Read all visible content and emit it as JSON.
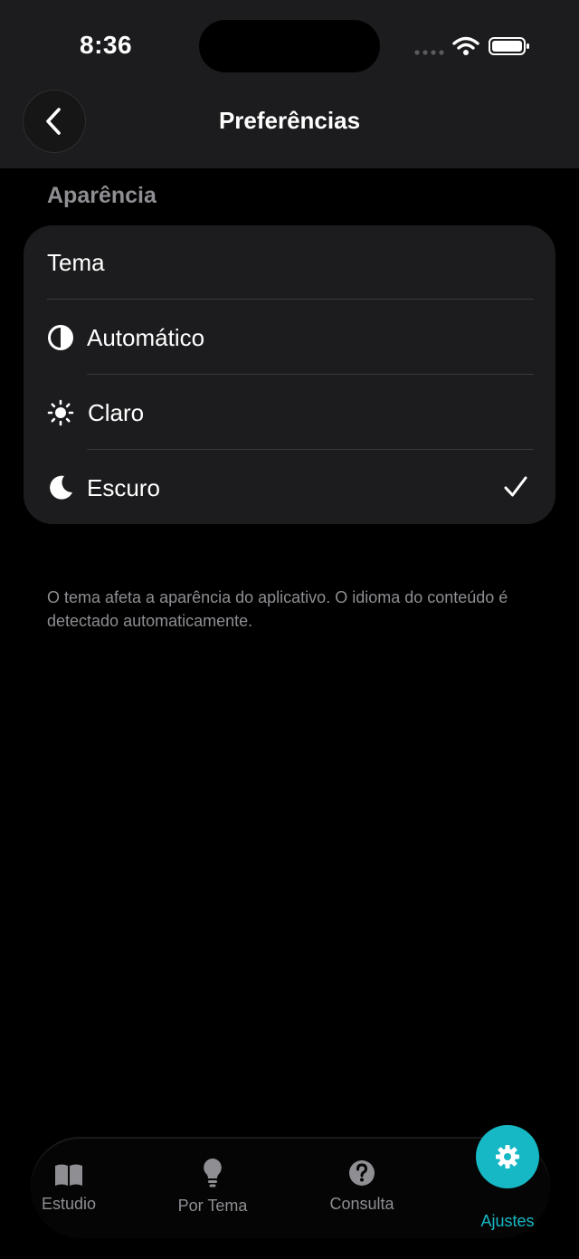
{
  "status_bar": {
    "time": "8:36",
    "icons": [
      "signal-dots-icon",
      "wifi-icon",
      "battery-icon"
    ]
  },
  "nav": {
    "title": "Preferências",
    "back_icon": "chevron-left-icon"
  },
  "appearance": {
    "section_title": "Aparência",
    "theme_header": "Tema",
    "options": [
      {
        "label": "Automático",
        "icon": "half-circle-icon",
        "selected": false
      },
      {
        "label": "Claro",
        "icon": "sun-icon",
        "selected": false
      },
      {
        "label": "Escuro",
        "icon": "moon-icon",
        "selected": true
      }
    ]
  },
  "footnote": "O tema afeta a aparência do aplicativo. O idioma do conteúdo é detectado automaticamente.",
  "tab_bar": {
    "tabs": [
      {
        "label": "Estudio",
        "icon": "book-icon",
        "active": false
      },
      {
        "label": "Por Tema",
        "icon": "lightbulb-icon",
        "active": false
      },
      {
        "label": "Consulta",
        "icon": "question-icon",
        "active": false
      },
      {
        "label": "Ajustes",
        "icon": "gear-icon",
        "active": true
      }
    ]
  },
  "colors": {
    "accent": "#17b8c5",
    "background": "#000000",
    "card": "#1c1c1e",
    "secondary_text": "#8e8e93"
  }
}
